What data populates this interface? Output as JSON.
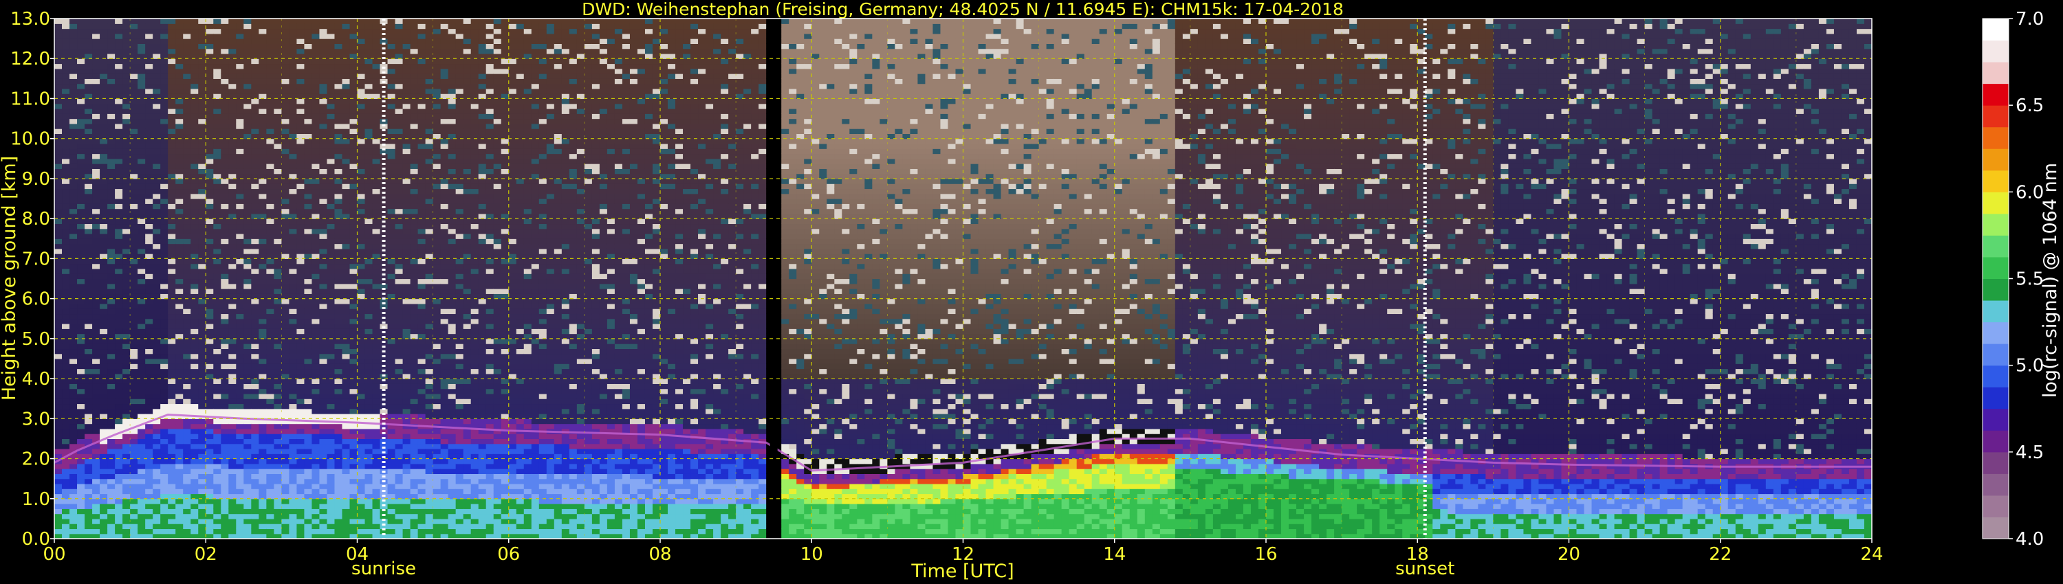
{
  "chart_data": {
    "type": "heatmap",
    "title": "DWD: Weihenstephan (Freising, Germany; 48.4025 N / 11.6945 E):    CHM15k: 17-04-2018",
    "xlabel": "Time [UTC]",
    "ylabel": "Height above ground [km]",
    "xlim": [
      0,
      24
    ],
    "ylim": [
      0,
      13
    ],
    "x_ticks": [
      0,
      2,
      4,
      6,
      8,
      10,
      12,
      14,
      16,
      18,
      20,
      22,
      24
    ],
    "x_tick_labels": [
      "00",
      "02",
      "04",
      "06",
      "08",
      "10",
      "12",
      "14",
      "16",
      "18",
      "20",
      "22",
      "24"
    ],
    "y_ticks": [
      0,
      1,
      2,
      3,
      4,
      5,
      6,
      7,
      8,
      9,
      10,
      11,
      12,
      13
    ],
    "y_tick_labels": [
      "0.0",
      "1.0",
      "2.0",
      "3.0",
      "4.0",
      "5.0",
      "6.0",
      "7.0",
      "8.0",
      "9.0",
      "10.0",
      "11.0",
      "12.0",
      "13.0"
    ],
    "grid": true,
    "annotations": [
      {
        "label": "sunrise",
        "x": 4.35
      },
      {
        "label": "sunset",
        "x": 18.1
      }
    ],
    "data_gap": {
      "start": 9.45,
      "end": 9.55
    },
    "boundary_layer_top": {
      "x": [
        0.0,
        0.3,
        0.8,
        1.5,
        2.5,
        4.0,
        6.0,
        8.0,
        9.4,
        10.0,
        11.0,
        12.0,
        13.0,
        14.0,
        15.0,
        16.0,
        17.0,
        18.0,
        19.0,
        20.0,
        22.0,
        24.0
      ],
      "y": [
        1.9,
        2.2,
        2.6,
        3.1,
        3.0,
        2.9,
        2.7,
        2.6,
        2.4,
        1.7,
        1.8,
        1.9,
        2.2,
        2.5,
        2.5,
        2.3,
        2.1,
        2.0,
        1.9,
        1.85,
        1.8,
        1.8
      ]
    },
    "colorbar": {
      "label": "log(rc-signal) @ 1064 nm",
      "range": [
        4.0,
        7.0
      ],
      "ticks": [
        4.0,
        4.5,
        5.0,
        5.5,
        6.0,
        6.5,
        7.0
      ],
      "tick_labels": [
        "4.0",
        "4.5",
        "5.0",
        "5.5",
        "6.0",
        "6.5",
        "7.0"
      ],
      "colors": [
        "#a88ea0",
        "#9e7898",
        "#8c5e8e",
        "#7a3f84",
        "#6a1f8e",
        "#4b1aa8",
        "#1f2fd0",
        "#2f5ae8",
        "#5a84f0",
        "#86a8f4",
        "#5fc8d8",
        "#20a040",
        "#35c050",
        "#5cd870",
        "#9ef060",
        "#e8f030",
        "#f8c818",
        "#f09a10",
        "#ee6a10",
        "#e83018",
        "#e00010",
        "#f0c8c8",
        "#f4e8e8",
        "#ffffff"
      ]
    }
  },
  "theme": {
    "background": "#000000",
    "text": "#ffff33",
    "grid": "#c8c800",
    "colorbar_text": "#ffffff"
  }
}
